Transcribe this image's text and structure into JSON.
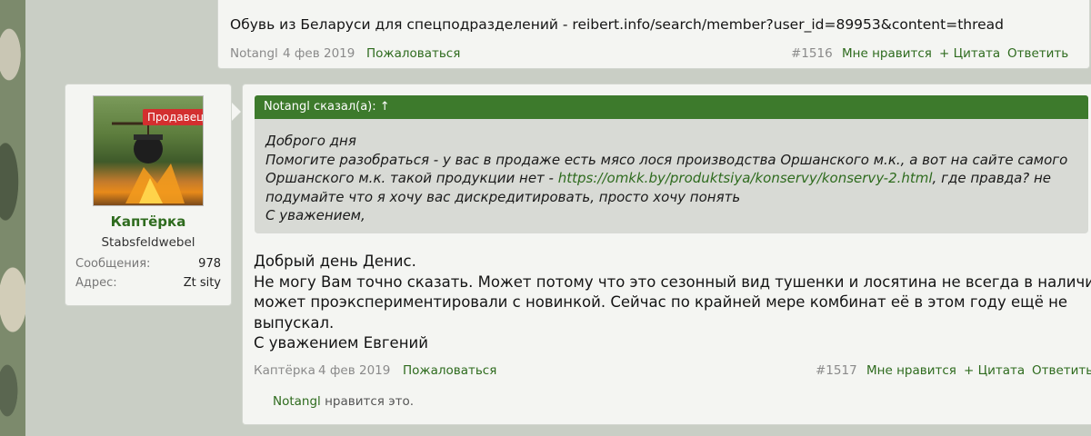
{
  "prev_post": {
    "text": "Обувь из Беларуси для спецподразделений - reibert.info/search/member?user_id=89953&content=thread",
    "author": "Notangl",
    "date": "4 фев 2019",
    "report": "Пожаловаться",
    "number": "#1516",
    "like": "Мне нравится",
    "quote": "+ Цитата",
    "reply": "Ответить"
  },
  "user": {
    "badge": "Продавец",
    "name": "Каптёрка",
    "title": "Stabsfeldwebel",
    "messages_label": "Сообщения:",
    "messages_value": "978",
    "address_label": "Адрес:",
    "address_value": "Zt sity"
  },
  "post": {
    "quote_header": "Notangl сказал(а): ↑",
    "quote_lines": {
      "l1": "Доброго дня",
      "l2": "Помогите разобраться - у вас в продаже есть мясо лося производства Оршанского м.к., а вот на сайте самого",
      "l3a": "Оршанского м.к. такой продукции нет - ",
      "l3link": "https://omkk.by/produktsiya/konservy/konservy-2.html",
      "l3b": ", где правда? не",
      "l4": "подумайте что я хочу вас дискредитировать, просто хочу понять",
      "l5": "С уважением,"
    },
    "message_lines": {
      "l1": "Добрый день Денис.",
      "l2": "Не могу Вам точно сказать. Может потому что это сезонный вид тушенки и лосятина не всегда в наличии, а",
      "l3": "может проэкспериментировали с новинкой. Сейчас по крайней мере комбинат её в этом году ещё не",
      "l4": "выпускал.",
      "l5": "С уважением Евгений"
    },
    "author": "Каптёрка",
    "date": "4 фев 2019",
    "report": "Пожаловаться",
    "number": "#1517",
    "like": "Мне нравится",
    "quote": "+ Цитата",
    "reply": "Ответить",
    "likes_user": "Notangl",
    "likes_text": "нравится это."
  },
  "colors": {
    "accent_green": "#2e6b1e",
    "quote_header_bg": "#3d7a2c",
    "badge_red": "#d32f2f"
  }
}
